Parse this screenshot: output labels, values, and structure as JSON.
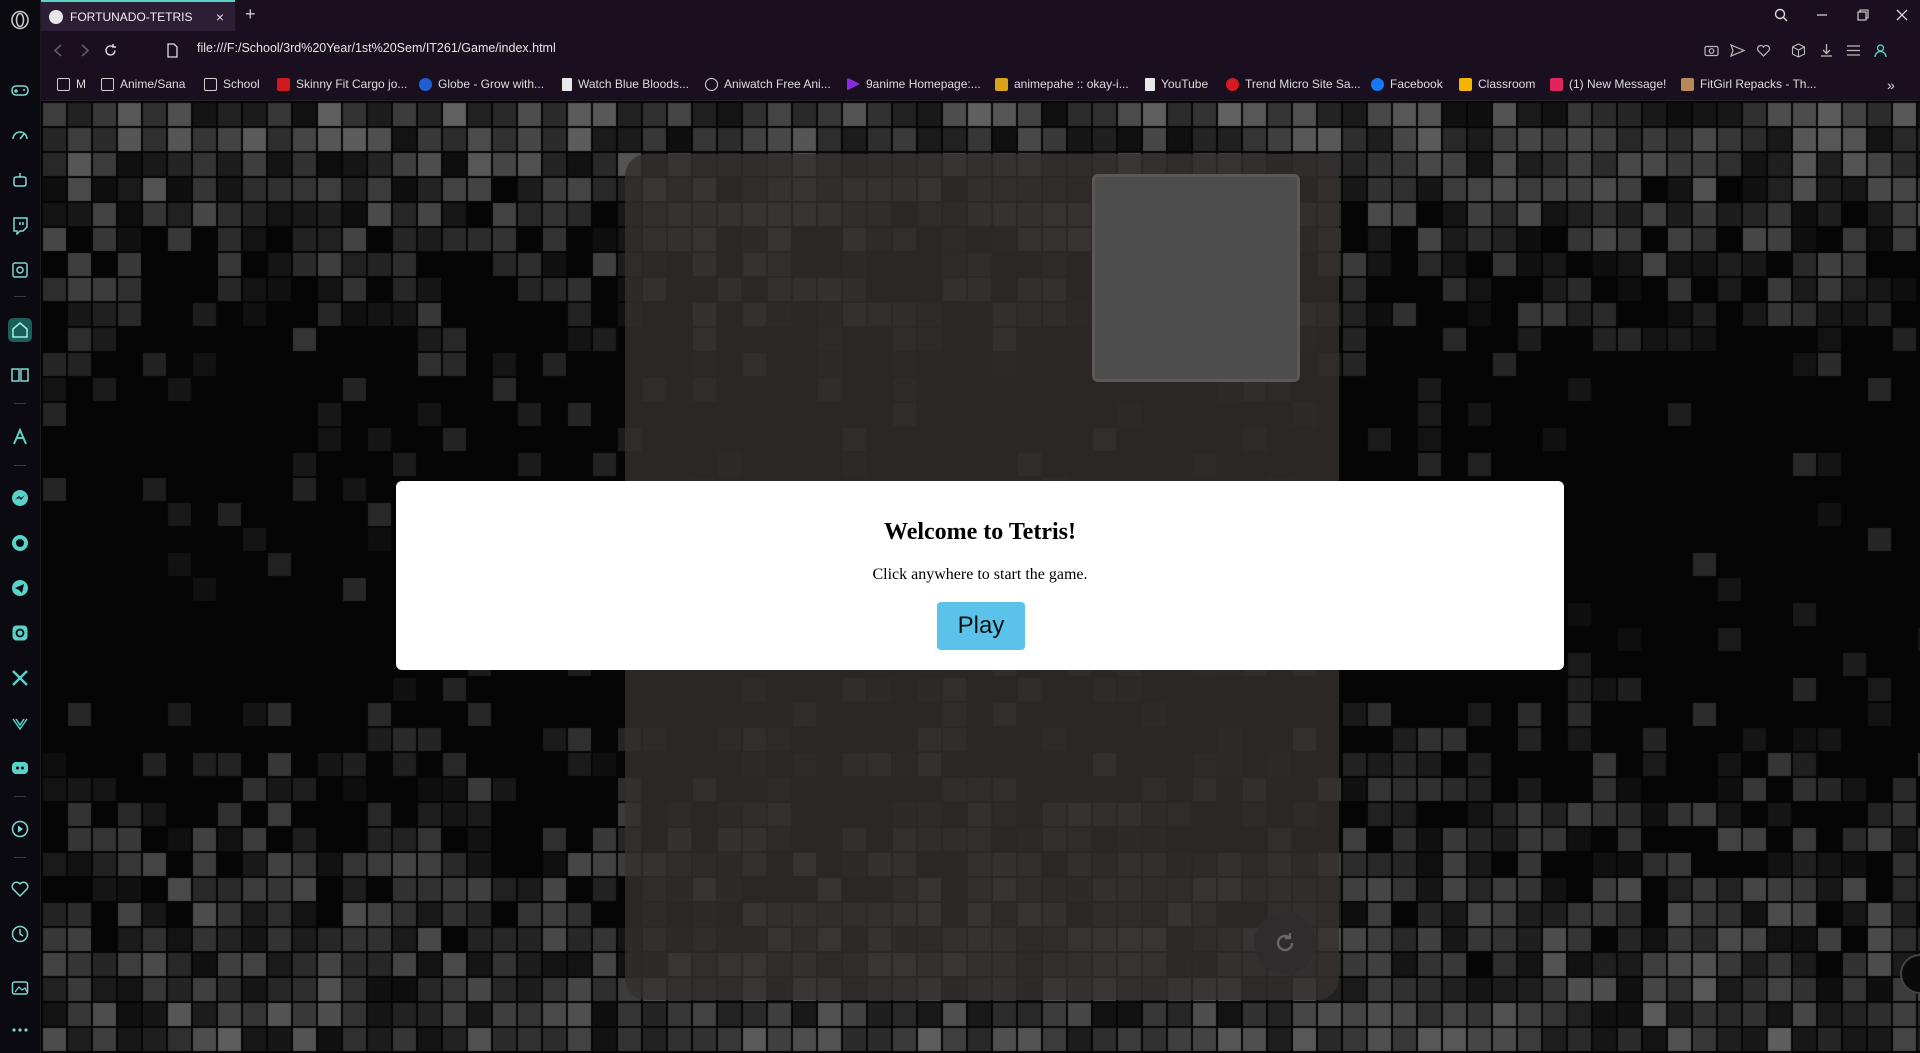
{
  "browser": {
    "tab_title": "FORTUNADO-TETRIS",
    "close_tab": "×",
    "new_tab": "+",
    "url": "file:///F:/School/3rd%20Year/1st%20Sem/IT261/Game/index.html",
    "overflow": "»"
  },
  "bookmarks": [
    {
      "label": "M",
      "icon": "folder"
    },
    {
      "label": "Anime/Sana",
      "icon": "folder"
    },
    {
      "label": "School",
      "icon": "folder"
    },
    {
      "label": "Skinny Fit Cargo jo...",
      "icon": "hm"
    },
    {
      "label": "Globe - Grow with...",
      "icon": "globe"
    },
    {
      "label": "Watch Blue Bloods...",
      "icon": "page"
    },
    {
      "label": "Aniwatch Free Ani...",
      "icon": "aniwatch"
    },
    {
      "label": "9anime Homepage:...",
      "icon": "9anime"
    },
    {
      "label": "animepahe :: okay-i...",
      "icon": "animepahe"
    },
    {
      "label": "YouTube",
      "icon": "page"
    },
    {
      "label": "Trend Micro Site Sa...",
      "icon": "trendmicro"
    },
    {
      "label": "Facebook",
      "icon": "facebook"
    },
    {
      "label": "Classroom",
      "icon": "classroom"
    },
    {
      "label": "(1) New Message!",
      "icon": "kik"
    },
    {
      "label": "FitGirl Repacks - Th...",
      "icon": "fitgirl"
    }
  ],
  "modal": {
    "title": "Welcome to Tetris!",
    "message": "Click anywhere to start the game.",
    "play_label": "Play"
  },
  "colors": {
    "accent": "#59d3c8",
    "play_button": "#5bc2ea",
    "board": "#343030"
  }
}
